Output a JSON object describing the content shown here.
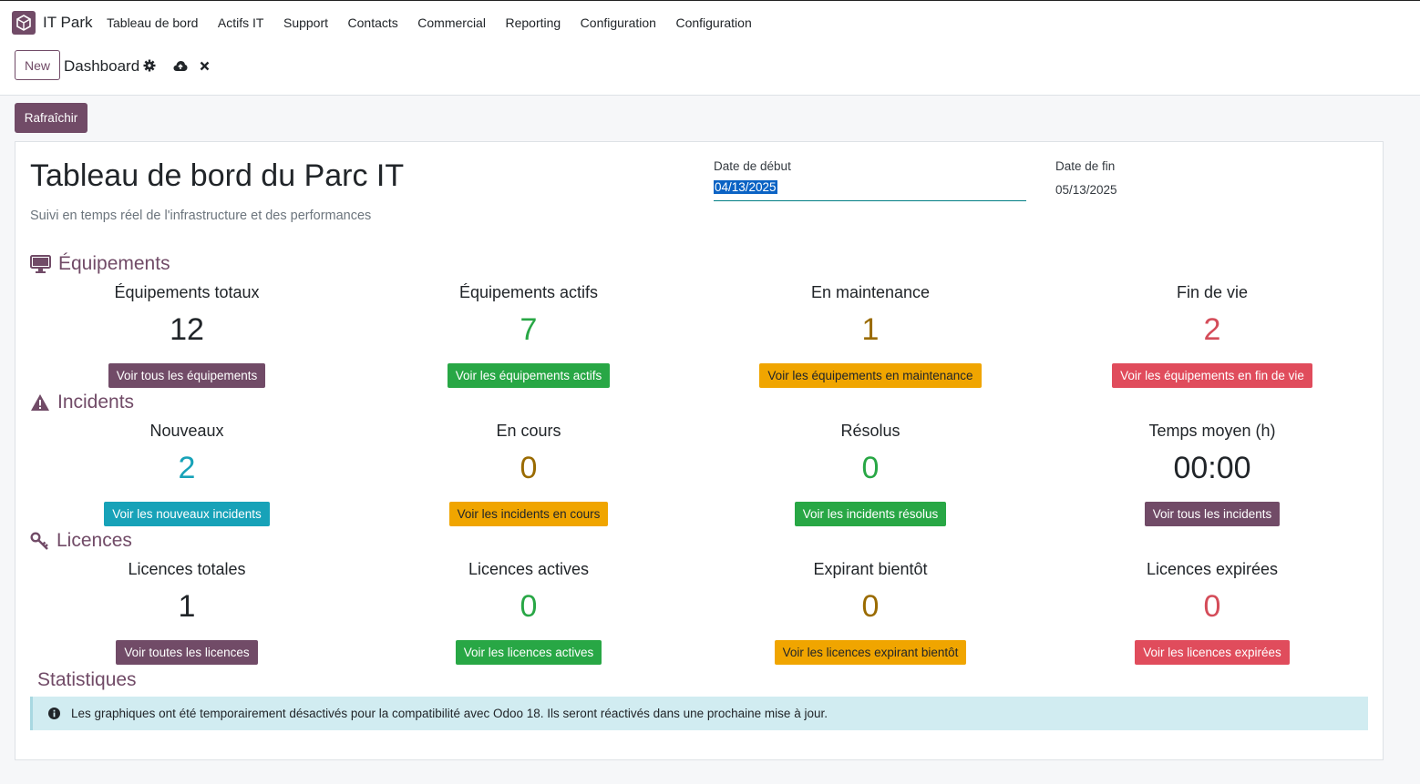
{
  "app": {
    "name": "IT Park"
  },
  "menu": [
    "Tableau de bord",
    "Actifs IT",
    "Support",
    "Contacts",
    "Commercial",
    "Reporting",
    "Configuration",
    "Configuration"
  ],
  "control_panel": {
    "new_label": "New",
    "title": "Dashboard"
  },
  "refresh_label": "Rafraîchir",
  "header": {
    "title": "Tableau de bord du Parc IT",
    "subtitle": "Suivi en temps réel de l'infrastructure et des performances",
    "start_date_label": "Date de début",
    "start_date_value": "04/13/2025",
    "end_date_label": "Date de fin",
    "end_date_value": "05/13/2025"
  },
  "sections": {
    "equipment": {
      "title": "Équipements",
      "stats": [
        {
          "label": "Équipements totaux",
          "value": "12",
          "button": "Voir tous les équipements"
        },
        {
          "label": "Équipements actifs",
          "value": "7",
          "button": "Voir les équipements actifs"
        },
        {
          "label": "En maintenance",
          "value": "1",
          "button": "Voir les équipements en maintenance"
        },
        {
          "label": "Fin de vie",
          "value": "2",
          "button": "Voir les équipements en fin de vie"
        }
      ]
    },
    "incidents": {
      "title": "Incidents",
      "stats": [
        {
          "label": "Nouveaux",
          "value": "2",
          "button": "Voir les nouveaux incidents"
        },
        {
          "label": "En cours",
          "value": "0",
          "button": "Voir les incidents en cours"
        },
        {
          "label": "Résolus",
          "value": "0",
          "button": "Voir les incidents résolus"
        },
        {
          "label": "Temps moyen (h)",
          "value": "00:00",
          "button": "Voir tous les incidents"
        }
      ]
    },
    "licenses": {
      "title": "Licences",
      "stats": [
        {
          "label": "Licences totales",
          "value": "1",
          "button": "Voir toutes les licences"
        },
        {
          "label": "Licences actives",
          "value": "0",
          "button": "Voir les licences actives"
        },
        {
          "label": "Expirant bientôt",
          "value": "0",
          "button": "Voir les licences expirant bientôt"
        },
        {
          "label": "Licences expirées",
          "value": "0",
          "button": "Voir les licences expirées"
        }
      ]
    }
  },
  "statistics": {
    "title": "Statistiques",
    "alert": "Les graphiques ont été temporairement désactivés pour la compatibilité avec Odoo 18. Ils seront réactivés dans une prochaine mise à jour."
  },
  "colors": {
    "brand": "#714b67",
    "success": "#28a745",
    "warning": "#f0a500",
    "danger": "#e04c5c",
    "info": "#17a2b8"
  }
}
